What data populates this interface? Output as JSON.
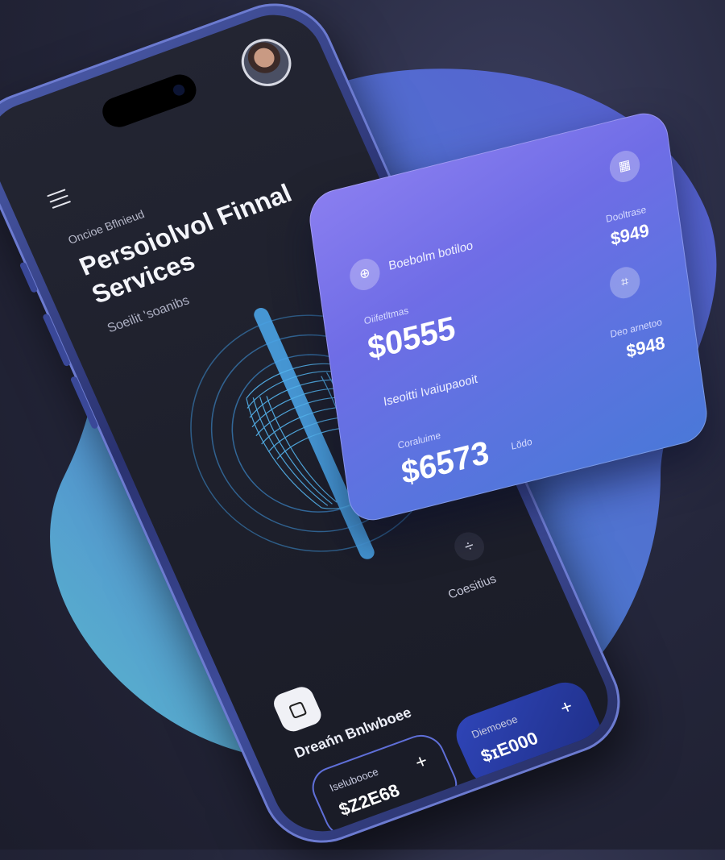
{
  "phone": {
    "eyebrow": "Oncioe Bflnieud",
    "title": "Persoiolvol Finnal Services",
    "subtitle": "Soeilit 'soanibs",
    "side_action_label": "Coesitius",
    "side_action_icon": "÷",
    "card_section_title": "Dreańn Bnlwboee",
    "card_icon": "wallet-icon",
    "pills": [
      {
        "label": "Iselubooce",
        "amount": "$Z2E68",
        "action": "+"
      },
      {
        "label": "Diemoeoe",
        "amount": "$ɪE000",
        "action": "+"
      }
    ]
  },
  "float_card": {
    "header_label": "Boebolm botiloo",
    "right_top_small": "Dooltrase",
    "right_top_value": "$949",
    "left_small": "Oiifetltmas",
    "big_value": "$0555",
    "mid_label": "Iseoitti Ivaiupaooit",
    "right_mid_small": "Deo arnetoo",
    "right_mid_value": "$948",
    "bottom_small": "Coraluime",
    "bottom_value": "$6573",
    "bottom_suffix": "Lǒdo"
  },
  "colors": {
    "accent": "#6f6de6",
    "card_gradient_start": "#8a7ef0",
    "card_gradient_end": "#4a78d8",
    "screen_bg": "#1d1f2b",
    "viz_blue": "#4aa3e6"
  }
}
